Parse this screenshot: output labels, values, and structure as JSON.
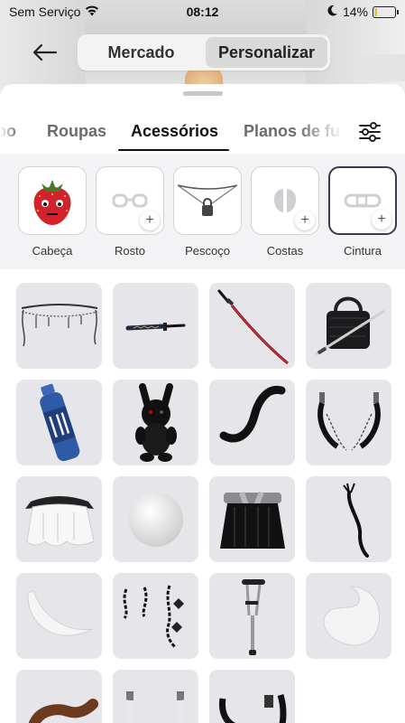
{
  "status_bar": {
    "carrier": "Sem Serviço",
    "time": "08:12",
    "battery_percent": "14%",
    "battery_level": 0.14
  },
  "header": {
    "segments": [
      {
        "label": "Mercado",
        "active": false
      },
      {
        "label": "Personalizar",
        "active": true
      }
    ]
  },
  "tabs": [
    {
      "label": "po",
      "active": false
    },
    {
      "label": "Roupas",
      "active": false
    },
    {
      "label": "Acessórios",
      "active": true
    },
    {
      "label": "Planos de fu",
      "active": false
    }
  ],
  "slots": [
    {
      "label": "Cabeça",
      "icon": "strawberry-head-icon",
      "filled": true
    },
    {
      "label": "Rosto",
      "icon": "glasses-icon",
      "filled": false
    },
    {
      "label": "Pescoço",
      "icon": "padlock-necklace-icon",
      "filled": true
    },
    {
      "label": "Costas",
      "icon": "wings-icon",
      "filled": false
    },
    {
      "label": "Cintura",
      "icon": "belt-icon",
      "filled": false,
      "selected": true
    }
  ],
  "items": [
    {
      "name": "chain-belt",
      "icon": "chain-belt-icon"
    },
    {
      "name": "katana-small",
      "icon": "katana-icon"
    },
    {
      "name": "red-katana",
      "icon": "red-katana-icon"
    },
    {
      "name": "black-bag-sword",
      "icon": "bag-sword-icon"
    },
    {
      "name": "blue-bottle",
      "icon": "bottle-icon"
    },
    {
      "name": "black-bunny-plush",
      "icon": "bunny-icon"
    },
    {
      "name": "black-tail",
      "icon": "tail-icon"
    },
    {
      "name": "black-suspenders",
      "icon": "suspenders-icon"
    },
    {
      "name": "white-tutu",
      "icon": "tutu-icon"
    },
    {
      "name": "white-fluff-ball",
      "icon": "fluff-ball-icon"
    },
    {
      "name": "black-gray-skirt",
      "icon": "skirt-icon"
    },
    {
      "name": "black-whip",
      "icon": "whip-icon"
    },
    {
      "name": "white-crescent-tail",
      "icon": "crescent-icon"
    },
    {
      "name": "chain-charms",
      "icon": "chain-charms-icon"
    },
    {
      "name": "crutch",
      "icon": "crutch-icon"
    },
    {
      "name": "white-fluffy-tail",
      "icon": "fluffy-tail-icon"
    },
    {
      "name": "brown-tail",
      "icon": "brown-tail-icon"
    },
    {
      "name": "white-straps",
      "icon": "white-straps-icon"
    },
    {
      "name": "black-straps",
      "icon": "black-straps-icon"
    }
  ],
  "colors": {
    "accent": "#111111",
    "tile_bg": "#e6e6ea",
    "battery": "#f2c230"
  }
}
